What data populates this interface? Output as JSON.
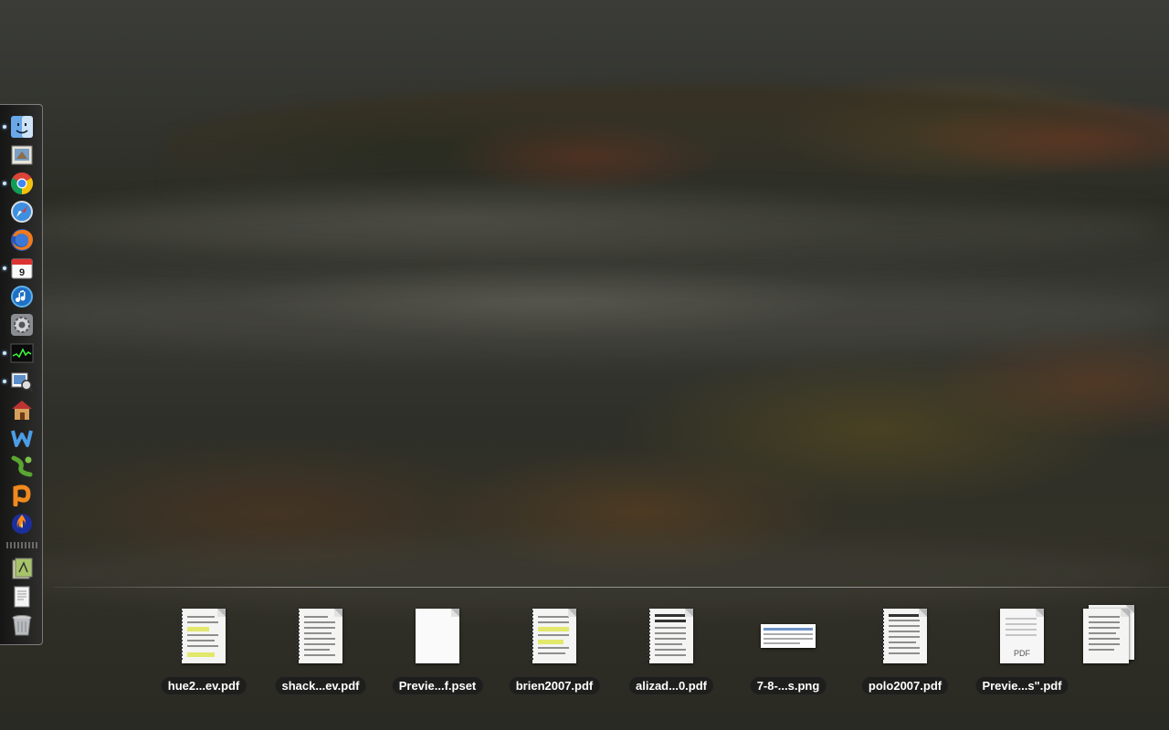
{
  "dock": {
    "items": [
      {
        "name": "finder-icon",
        "running": true
      },
      {
        "name": "preview-icon",
        "running": false
      },
      {
        "name": "chrome-icon",
        "running": true
      },
      {
        "name": "safari-icon",
        "running": false
      },
      {
        "name": "firefox-icon",
        "running": false
      },
      {
        "name": "ical-icon",
        "running": true,
        "text": "9"
      },
      {
        "name": "itunes-icon",
        "running": false
      },
      {
        "name": "system-preferences-icon",
        "running": false
      },
      {
        "name": "activity-monitor-icon",
        "running": true
      },
      {
        "name": "preview-photos-icon",
        "running": true
      },
      {
        "name": "home-app-icon",
        "running": false
      },
      {
        "name": "w-app-icon",
        "running": false
      },
      {
        "name": "green-app-icon",
        "running": false
      },
      {
        "name": "p-app-icon",
        "running": false
      },
      {
        "name": "vlc-fire-icon",
        "running": false
      },
      {
        "name": "applications-stack-icon",
        "running": false
      },
      {
        "name": "documents-stack-icon",
        "running": false
      },
      {
        "name": "trash-icon",
        "running": false
      }
    ]
  },
  "stack": {
    "files": [
      {
        "label": "hue2...ev.pdf",
        "kind": "pdf-highlight"
      },
      {
        "label": "shack...ev.pdf",
        "kind": "pdf-spiral"
      },
      {
        "label": "Previe...f.pset",
        "kind": "blank"
      },
      {
        "label": "brien2007.pdf",
        "kind": "pdf-highlight"
      },
      {
        "label": "alizad...0.pdf",
        "kind": "pdf-spiral"
      },
      {
        "label": "7-8-...s.png",
        "kind": "png"
      },
      {
        "label": "polo2007.pdf",
        "kind": "pdf-spiral"
      },
      {
        "label": "Previe...s\".pdf",
        "kind": "pdf-badge",
        "badge": "PDF"
      },
      {
        "label": "",
        "kind": "pdf-stack"
      }
    ]
  }
}
